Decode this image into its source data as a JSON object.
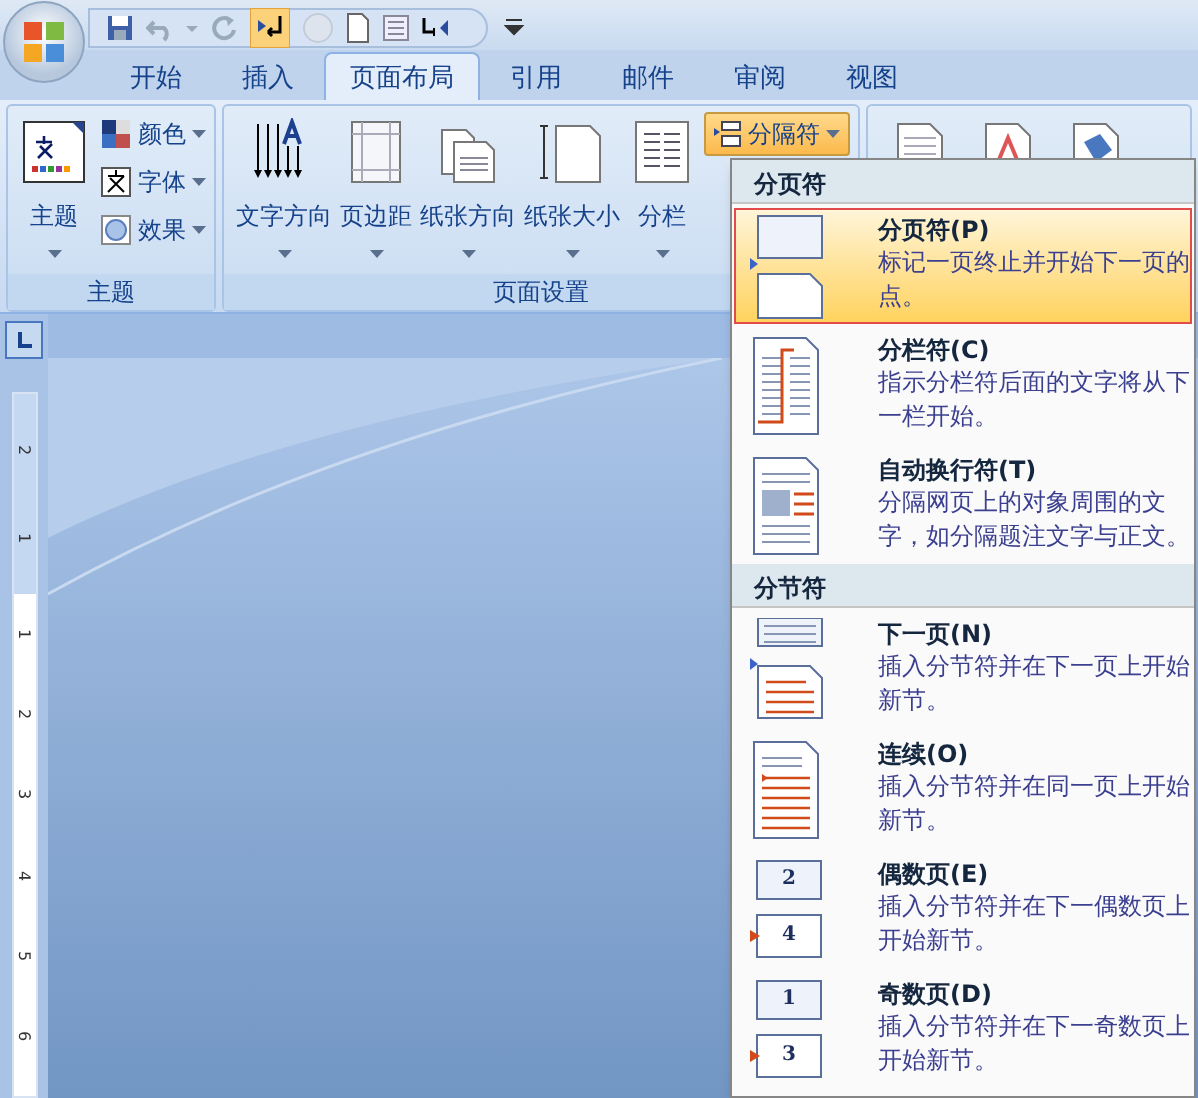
{
  "tabs": [
    {
      "label": "开始",
      "selected": false
    },
    {
      "label": "插入",
      "selected": false
    },
    {
      "label": "页面布局",
      "selected": true
    },
    {
      "label": "引用",
      "selected": false
    },
    {
      "label": "邮件",
      "selected": false
    },
    {
      "label": "审阅",
      "selected": false
    },
    {
      "label": "视图",
      "selected": false
    }
  ],
  "ribbon": {
    "groups": [
      {
        "label": "主题",
        "big": [
          {
            "label": "主题",
            "kind": "theme"
          }
        ],
        "small": [
          {
            "label": "颜色",
            "kind": "colors"
          },
          {
            "label": "字体",
            "kind": "fonts"
          },
          {
            "label": "效果",
            "kind": "effects"
          }
        ]
      },
      {
        "label": "页面设置",
        "big": [
          {
            "label": "文字方向",
            "kind": "textdir"
          },
          {
            "label": "页边距",
            "kind": "margins"
          },
          {
            "label": "纸张方向",
            "kind": "orientation"
          },
          {
            "label": "纸张大小",
            "kind": "size"
          },
          {
            "label": "分栏",
            "kind": "columns"
          }
        ],
        "split": {
          "label": "分隔符",
          "active": true
        }
      }
    ]
  },
  "ruler": {
    "top_labels": [
      "2",
      "1"
    ],
    "labels": [
      "1",
      "2",
      "3",
      "4",
      "5",
      "6"
    ]
  },
  "menu": {
    "sections": [
      {
        "header": "分页符",
        "items": [
          {
            "title": "分页符(P)",
            "description": "标记一页终止并开始下一页的点。",
            "kind": "page_break",
            "selected": true
          },
          {
            "title": "分栏符(C)",
            "description": "指示分栏符后面的文字将从下一栏开始。",
            "kind": "column_break",
            "selected": false
          },
          {
            "title": "自动换行符(T)",
            "description": "分隔网页上的对象周围的文字，如分隔题注文字与正文。",
            "kind": "text_wrap",
            "selected": false
          }
        ]
      },
      {
        "header": "分节符",
        "items": [
          {
            "title": "下一页(N)",
            "description": "插入分节符并在下一页上开始新节。",
            "kind": "next_page",
            "selected": false
          },
          {
            "title": "连续(O)",
            "description": "插入分节符并在同一页上开始新节。",
            "kind": "continuous",
            "selected": false
          },
          {
            "title": "偶数页(E)",
            "description": "插入分节符并在下一偶数页上开始新节。",
            "kind": "even_page",
            "icon_numbers": [
              "2",
              "4"
            ],
            "selected": false
          },
          {
            "title": "奇数页(D)",
            "description": "插入分节符并在下一奇数页上开始新节。",
            "kind": "odd_page",
            "icon_numbers": [
              "1",
              "3"
            ],
            "selected": false
          }
        ]
      }
    ]
  }
}
